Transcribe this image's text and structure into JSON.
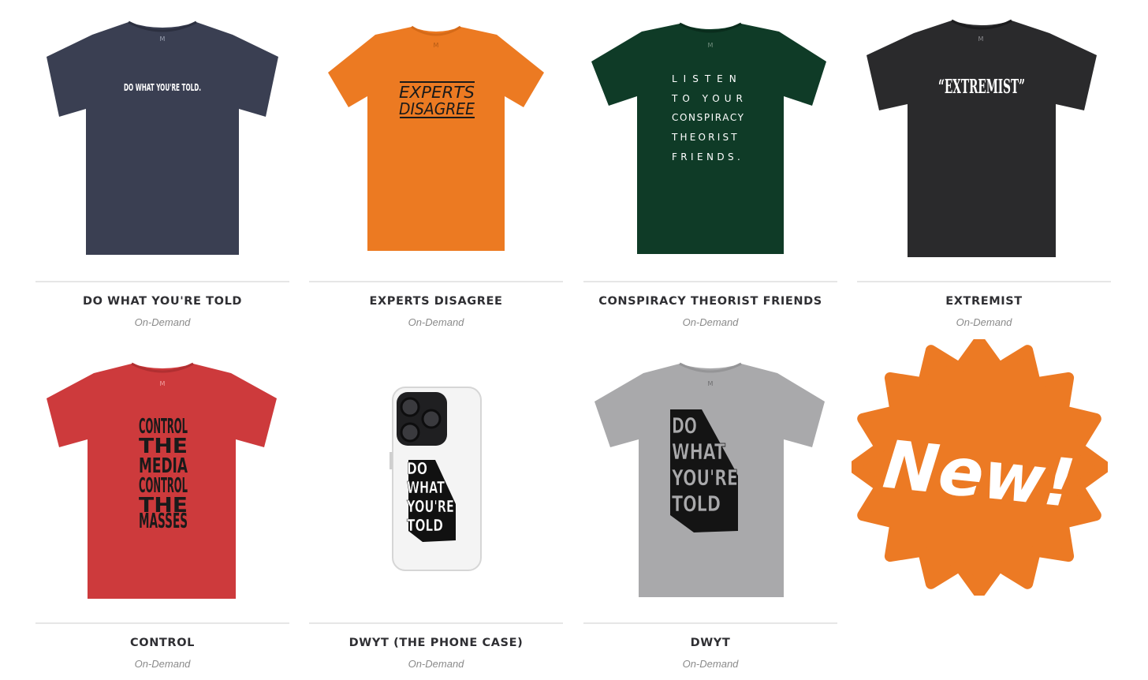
{
  "products": [
    {
      "title": "DO WHAT YOU'RE TOLD",
      "subtitle": "On-Demand",
      "shirt_color": "#3a3f52",
      "print_lines": [
        "DO WHAT YOU'RE TOLD."
      ],
      "collar_logo": "M"
    },
    {
      "title": "EXPERTS DISAGREE",
      "subtitle": "On-Demand",
      "shirt_color": "#ec7a22",
      "print_lines": [
        "EXPERTS",
        "DISAGREE"
      ],
      "collar_logo": "M"
    },
    {
      "title": "CONSPIRACY THEORIST FRIENDS",
      "subtitle": "On-Demand",
      "shirt_color": "#0f3b27",
      "print_lines": [
        "LISTEN",
        "TO YOUR",
        "CONSPIRACY",
        "THEORIST",
        "FRIENDS."
      ],
      "collar_logo": "M"
    },
    {
      "title": "EXTREMIST",
      "subtitle": "On-Demand",
      "shirt_color": "#2a2a2c",
      "print_lines": [
        "“EXTREMIST”"
      ],
      "collar_logo": "M"
    },
    {
      "title": "CONTROL",
      "subtitle": "On-Demand",
      "shirt_color": "#cd3a3c",
      "print_lines": [
        "CONTROL",
        "THE",
        "MEDIA",
        "CONTROL",
        "THE",
        "MASSES"
      ],
      "collar_logo": "M"
    },
    {
      "title": "DWYT (THE PHONE CASE)",
      "subtitle": "On-Demand",
      "case_color": "#f4f4f4",
      "print_lines": [
        "DO",
        "WHAT",
        "YOU'RE",
        "TOLD"
      ]
    },
    {
      "title": "DWYT",
      "subtitle": "On-Demand",
      "shirt_color": "#a9a9ab",
      "print_lines": [
        "DO",
        "WHAT",
        "YOU'RE",
        "TOLD"
      ],
      "collar_logo": "M"
    }
  ],
  "badge": {
    "text": "New!",
    "color": "#ec7a24",
    "text_color": "#ffffff"
  }
}
